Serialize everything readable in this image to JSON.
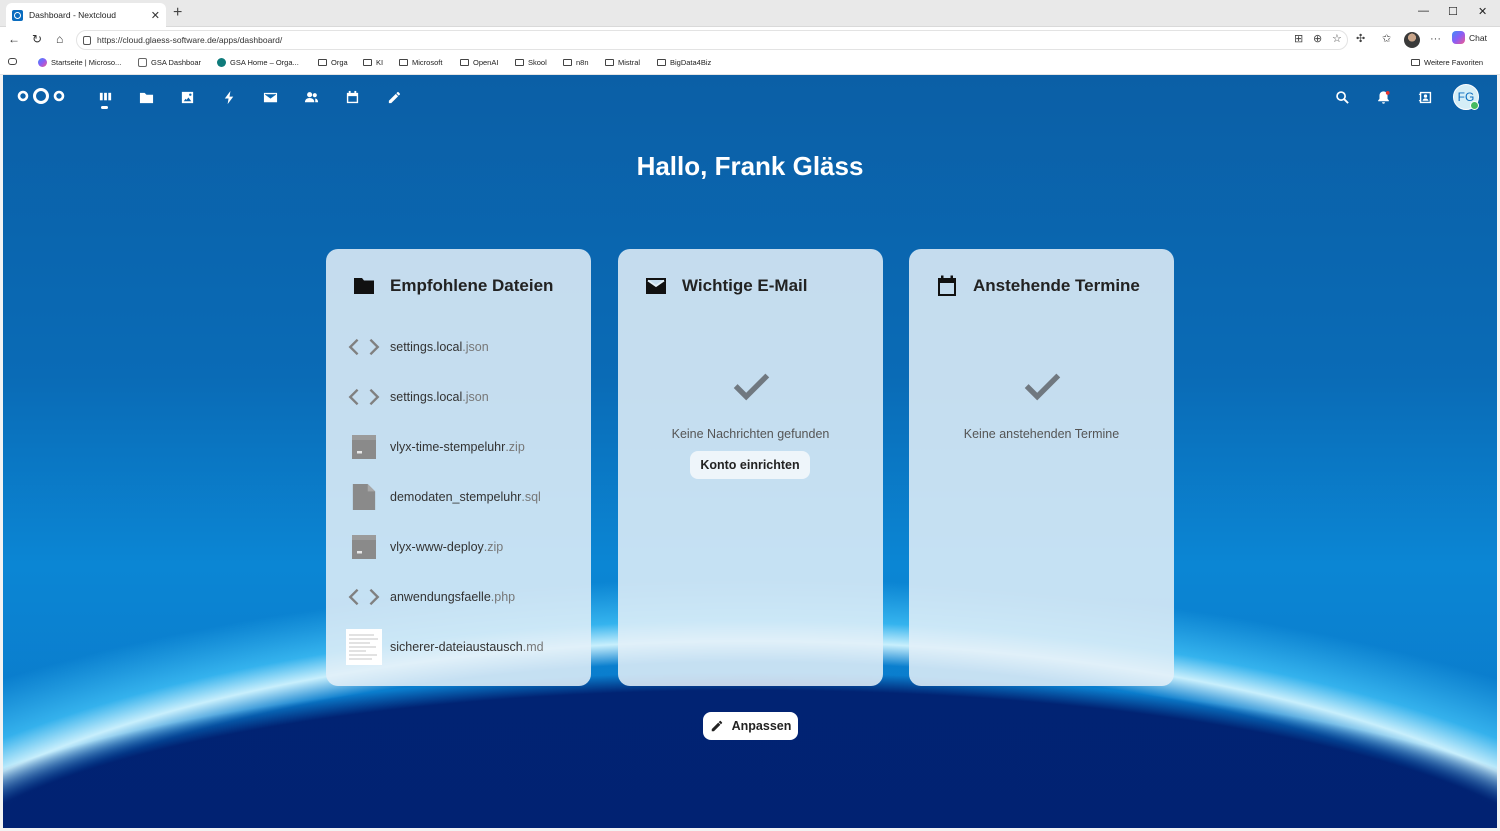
{
  "browser": {
    "tab_title": "Dashboard - Nextcloud",
    "tab_close": "✕",
    "new_tab": "+",
    "url": "https://cloud.glaess-software.de/apps/dashboard/",
    "chat_label": "Chat",
    "window_controls": [
      "—",
      "☐",
      "✕"
    ],
    "bookmarks": [
      {
        "label": "Startseite | Microso...",
        "icon": "copilot-icon"
      },
      {
        "label": "GSA Dashboar",
        "icon": "chart-icon"
      },
      {
        "label": "GSA Home – Orga...",
        "icon": "sharepoint-icon"
      },
      {
        "label": "Orga",
        "icon": "folder-icon"
      },
      {
        "label": "KI",
        "icon": "folder-icon"
      },
      {
        "label": "Microsoft",
        "icon": "folder-icon"
      },
      {
        "label": "OpenAI",
        "icon": "folder-icon"
      },
      {
        "label": "Skool",
        "icon": "folder-icon"
      },
      {
        "label": "n8n",
        "icon": "folder-icon"
      },
      {
        "label": "Mistral",
        "icon": "folder-icon"
      },
      {
        "label": "BigData4Biz",
        "icon": "folder-icon"
      }
    ],
    "other_favorites": "Weitere Favoriten"
  },
  "header": {
    "nav_icons": [
      "dashboard-icon",
      "files-icon",
      "photos-icon",
      "activity-icon",
      "mail-icon",
      "contacts-icon",
      "calendar-icon",
      "notes-icon"
    ],
    "right_icons": [
      "search-icon",
      "notifications-icon",
      "contacts-menu-icon"
    ],
    "avatar_initials": "FG",
    "accent": "#0a6cbf"
  },
  "greeting": "Hallo, Frank Gläss",
  "panels": {
    "files": {
      "title": "Empfohlene Dateien",
      "items": [
        {
          "name": "settings.local",
          "ext": ".json",
          "icon": "code-file-icon"
        },
        {
          "name": "settings.local",
          "ext": ".json",
          "icon": "code-file-icon"
        },
        {
          "name": "vlyx-time-stempeluhr",
          "ext": ".zip",
          "icon": "archive-file-icon"
        },
        {
          "name": "demodaten_stempeluhr",
          "ext": ".sql",
          "icon": "generic-file-icon"
        },
        {
          "name": "vlyx-www-deploy",
          "ext": ".zip",
          "icon": "archive-file-icon"
        },
        {
          "name": "anwendungsfaelle",
          "ext": ".php",
          "icon": "code-file-icon"
        },
        {
          "name": "sicherer-dateiaustausch",
          "ext": ".md",
          "icon": "document-preview-icon"
        }
      ]
    },
    "mail": {
      "title": "Wichtige E-Mail",
      "empty_text": "Keine Nachrichten gefunden",
      "button": "Konto einrichten"
    },
    "calendar": {
      "title": "Anstehende Termine",
      "empty_text": "Keine anstehenden Termine"
    }
  },
  "customize_button": "Anpassen"
}
